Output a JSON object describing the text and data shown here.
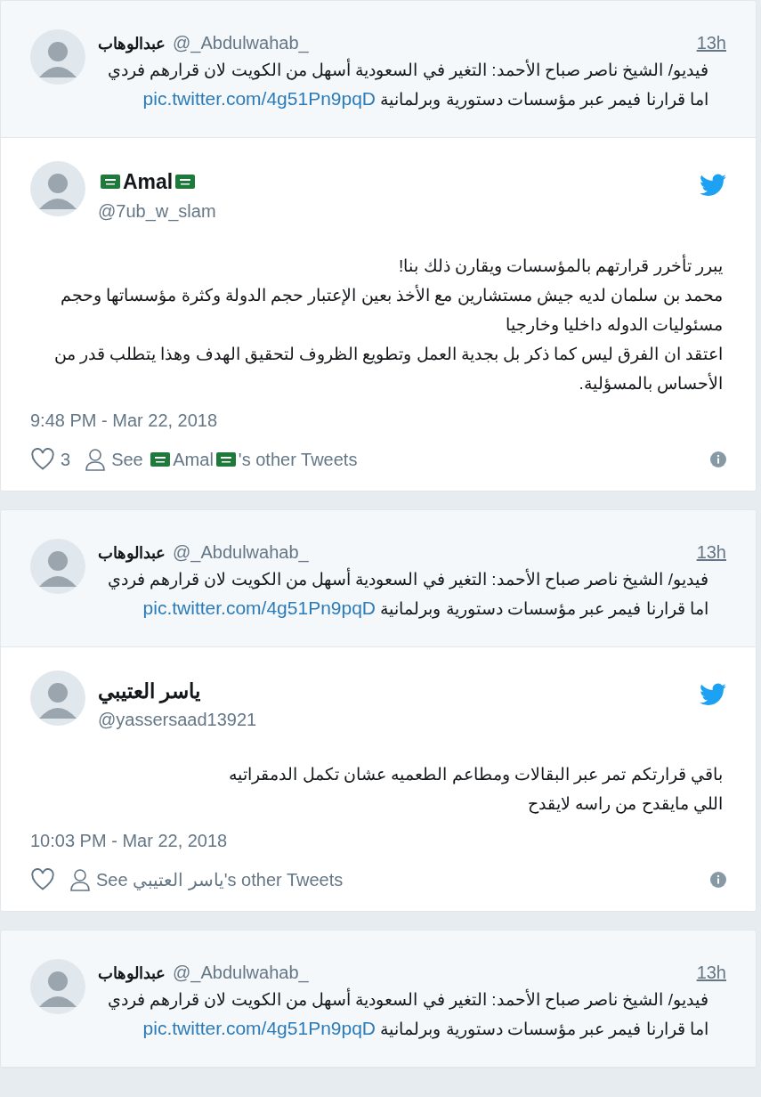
{
  "threads": [
    {
      "parent": {
        "name": "عبدالوهاب",
        "handle": "@_Abdulwahab_",
        "time": "13h",
        "text": "فيديو/ الشيخ ناصر صباح الأحمد: التغير في السعودية أسهل من الكويت لان قرارهم فردي اما قرارنا فيمر عبر مؤسسات دستورية وبرلمانية",
        "link": "pic.twitter.com/4g51Pn9pqD"
      },
      "reply": {
        "name": "Amal",
        "name_flags": true,
        "handle": "@7ub_w_slam",
        "lines": [
          "يبرر تأخرر قرارتهم بالمؤسسات ويقارن ذلك بنا!",
          "محمد بن سلمان لديه جيش مستشارين مع الأخذ بعين الإعتبار حجم الدولة وكثرة مؤسساتها وحجم مسئوليات الدوله داخليا وخارجيا",
          "اعتقد ان الفرق ليس كما ذكر بل بجدية العمل وتطويع الظروف لتحقيق الهدف وهذا يتطلب قدر من الأحساس بالمسؤلية."
        ],
        "date": "9:48 PM - Mar 22, 2018",
        "likes": "3",
        "see": "See",
        "see_name": "Amal",
        "see_suffix": "'s other Tweets"
      }
    },
    {
      "parent": {
        "name": "عبدالوهاب",
        "handle": "@_Abdulwahab_",
        "time": "13h",
        "text": "فيديو/ الشيخ ناصر صباح الأحمد: التغير في السعودية أسهل من الكويت لان قرارهم فردي اما قرارنا فيمر عبر مؤسسات دستورية وبرلمانية",
        "link": "pic.twitter.com/4g51Pn9pqD"
      },
      "reply": {
        "name": "ياسر العتيبي",
        "name_flags": false,
        "handle": "@yassersaad13921",
        "lines": [
          "باقي قرارتكم تمر عبر البقالات ومطاعم الطعميه عشان تكمل الدمقراتيه",
          "اللي مايقدح من راسه لايقدح"
        ],
        "date": "10:03 PM - Mar 22, 2018",
        "see": "See",
        "see_name": "ياسر العتيبي",
        "see_suffix": "'s other Tweets"
      }
    },
    {
      "parent": {
        "name": "عبدالوهاب",
        "handle": "@_Abdulwahab_",
        "time": "13h",
        "text": "فيديو/ الشيخ ناصر صباح الأحمد: التغير في السعودية أسهل من الكويت لان قرارهم فردي اما قرارنا فيمر عبر مؤسسات دستورية وبرلمانية",
        "link": "pic.twitter.com/4g51Pn9pqD"
      }
    }
  ]
}
